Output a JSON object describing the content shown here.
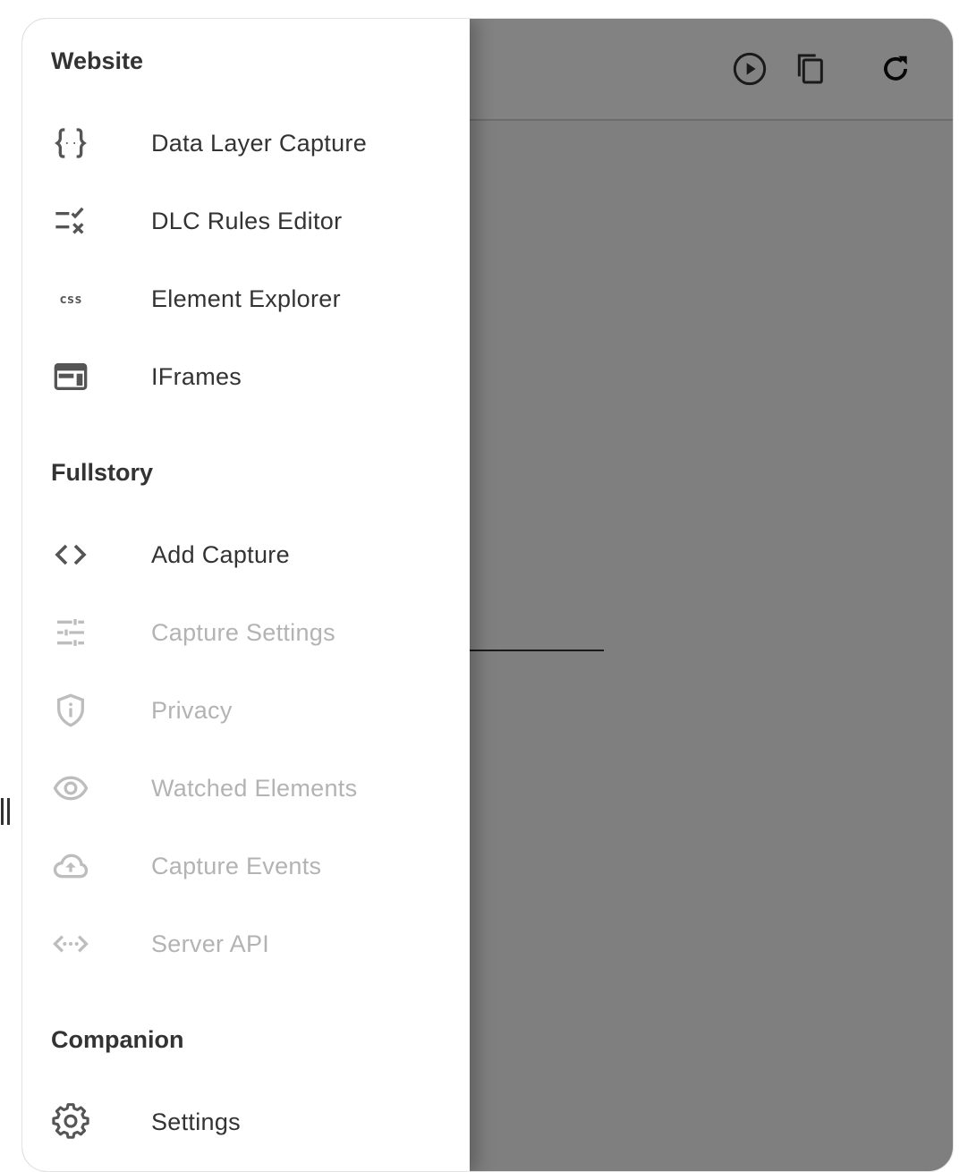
{
  "colors": {
    "text": "#333333",
    "disabled_text": "#b3b3b3",
    "icon": "#555555",
    "disabled_icon": "#bdbdbd",
    "scrim": "rgba(0,0,0,0.48)"
  },
  "drawer": {
    "sections": [
      {
        "title": "Website",
        "items": [
          {
            "label": "Data Layer Capture",
            "icon": "curly-braces-icon",
            "disabled": false
          },
          {
            "label": "DLC Rules Editor",
            "icon": "rule-icon",
            "disabled": false
          },
          {
            "label": "Element Explorer",
            "icon": "css-icon",
            "disabled": false
          },
          {
            "label": "IFrames",
            "icon": "web-layout-icon",
            "disabled": false
          }
        ]
      },
      {
        "title": "Fullstory",
        "items": [
          {
            "label": "Add Capture",
            "icon": "code-icon",
            "disabled": false
          },
          {
            "label": "Capture Settings",
            "icon": "tune-icon",
            "disabled": true
          },
          {
            "label": "Privacy",
            "icon": "shield-icon",
            "disabled": true
          },
          {
            "label": "Watched Elements",
            "icon": "eye-icon",
            "disabled": true
          },
          {
            "label": "Capture Events",
            "icon": "cloud-upload-icon",
            "disabled": true
          },
          {
            "label": "Server API",
            "icon": "settings-ethernet-icon",
            "disabled": true
          }
        ]
      },
      {
        "title": "Companion",
        "items": [
          {
            "label": "Settings",
            "icon": "gear-icon",
            "disabled": false
          }
        ]
      }
    ]
  },
  "toolbar": {
    "icons": [
      "play-circle-icon",
      "copy-icon",
      "refresh-icon"
    ]
  }
}
